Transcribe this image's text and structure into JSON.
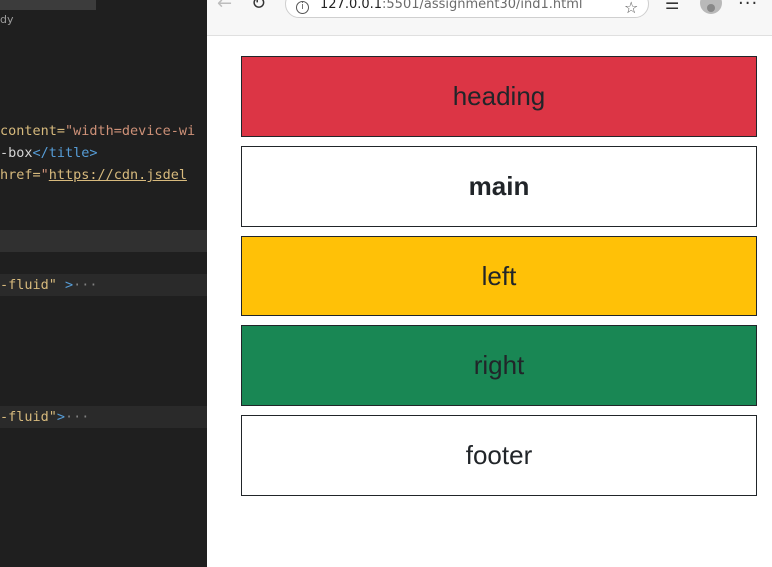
{
  "editor": {
    "top_tab_text": "",
    "top_label": "dy",
    "lines": {
      "line1_attr": "content=",
      "line1_str": "\"width=device-wi",
      "line2_pre": "-box",
      "line2_close": "</title>",
      "line3_attr": " href=",
      "line3_q": "\"",
      "line3_link": "https://cdn.jsdel",
      "line4_str": "-fluid\"",
      "line4_gt": " >",
      "line4_ell": "···",
      "line5_str": "-fluid\"",
      "line5_gt": ">",
      "line5_ell": "···"
    }
  },
  "browser": {
    "url_main": "127.0.0.1",
    "url_rest": ":5501/assignment30/ind1.html",
    "icons": {
      "back": "back-arrow-icon",
      "reload": "reload-icon",
      "info": "info-icon",
      "star": "star-icon",
      "favorites": "favorites-icon",
      "profile": "profile-avatar-icon",
      "more": "more-icon"
    }
  },
  "page": {
    "blocks": [
      {
        "label": "heading",
        "bg": "#dc3545"
      },
      {
        "label": "main",
        "bg": "#ffffff"
      },
      {
        "label": "left",
        "bg": "#ffc107"
      },
      {
        "label": "right",
        "bg": "#198754"
      },
      {
        "label": "footer",
        "bg": "#ffffff"
      }
    ]
  }
}
